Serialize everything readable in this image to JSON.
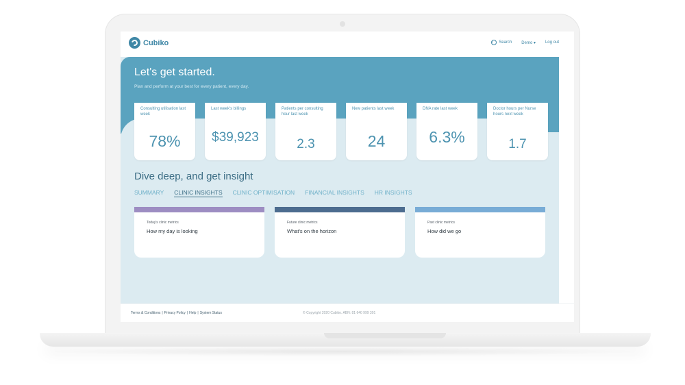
{
  "app": {
    "logo_text": "Cubiko",
    "brand_color": "#3f87a6",
    "hero_color": "#5aa3bf"
  },
  "topnav": {
    "search_label": "Search",
    "search_icon": "info-icon",
    "demo_label": "Demo ▾",
    "logout_label": "Log out"
  },
  "hero": {
    "title": "Let's get started.",
    "subtitle": "Plan and perform at your best for every patient, every day."
  },
  "kpis": [
    {
      "label": "Consulting utilisation last week",
      "value": "78%"
    },
    {
      "label": "Last week's billings",
      "value": "$39,923"
    },
    {
      "label": "Patients per consulting hour last week",
      "value": "2.3"
    },
    {
      "label": "New patients last week",
      "value": "24"
    },
    {
      "label": "DNA rate last week",
      "value": "6.3%"
    },
    {
      "label": "Doctor hours per Nurse hours next week",
      "value": "1.7"
    }
  ],
  "insights": {
    "title": "Dive deep, and get insight",
    "tabs": [
      "SUMMARY",
      "CLINIC INSIGHTS",
      "CLINIC OPTIMISATION",
      "FINANCIAL INSIGHTS",
      "HR INSIGHTS"
    ],
    "active_tab": "CLINIC INSIGHTS",
    "panels": [
      {
        "kicker": "Today's clinic metrics",
        "title": "How my day is looking",
        "color": "#9d8dc2"
      },
      {
        "kicker": "Future clinic metrics",
        "title": "What's on the horizon",
        "color": "#4c6c8f"
      },
      {
        "kicker": "Past clinic metrics",
        "title": "How did we go",
        "color": "#78acd6"
      }
    ]
  },
  "footer": {
    "links": [
      "Terms & Conditions",
      "|",
      "Privacy Policy",
      "|",
      "Help",
      "|",
      "System Status"
    ],
    "copyright": "© Copyright 2020 Cubiko. ABN: 81 640 999 391"
  }
}
